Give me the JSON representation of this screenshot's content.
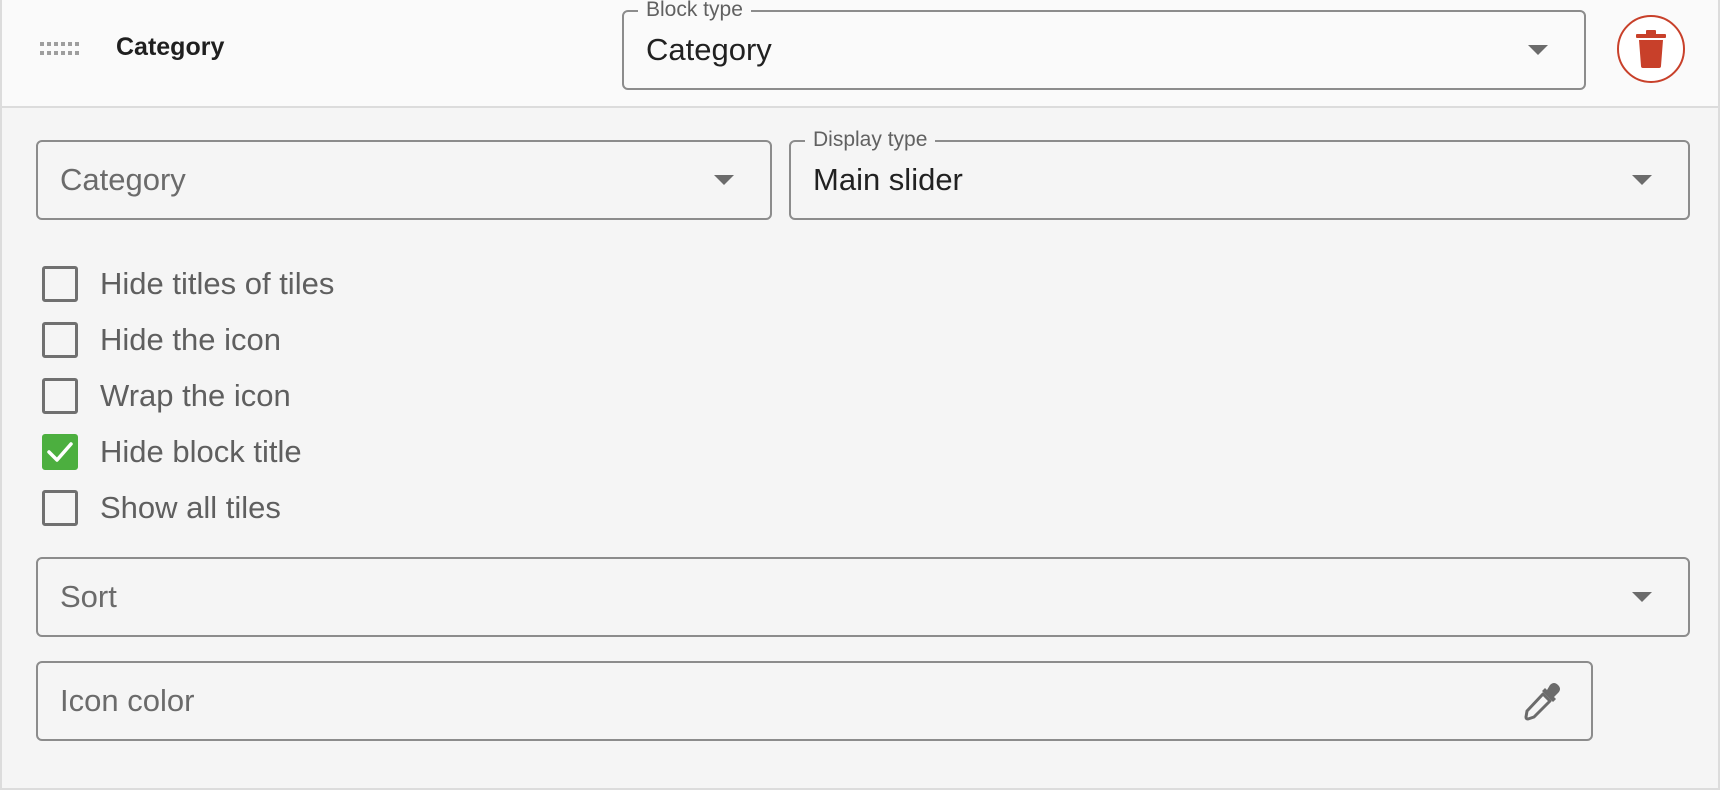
{
  "header": {
    "title": "Category",
    "block_type": {
      "label": "Block type",
      "value": "Category"
    }
  },
  "fields": {
    "category": {
      "placeholder": "Category"
    },
    "display_type": {
      "label": "Display type",
      "value": "Main slider"
    },
    "sort": {
      "placeholder": "Sort"
    },
    "icon_color": {
      "placeholder": "Icon color"
    }
  },
  "checkboxes": [
    {
      "label": "Hide titles of tiles",
      "checked": false
    },
    {
      "label": "Hide the icon",
      "checked": false
    },
    {
      "label": "Wrap the icon",
      "checked": false
    },
    {
      "label": "Hide block title",
      "checked": true
    },
    {
      "label": "Show all tiles",
      "checked": false
    }
  ],
  "colors": {
    "accent_check": "#4caf3f",
    "delete": "#c8402a",
    "border": "#8c8c8c"
  },
  "icons": {
    "drag": "drag-handle-icon",
    "delete": "trash-icon",
    "picker": "eyedropper-icon",
    "caret": "chevron-down-icon"
  }
}
